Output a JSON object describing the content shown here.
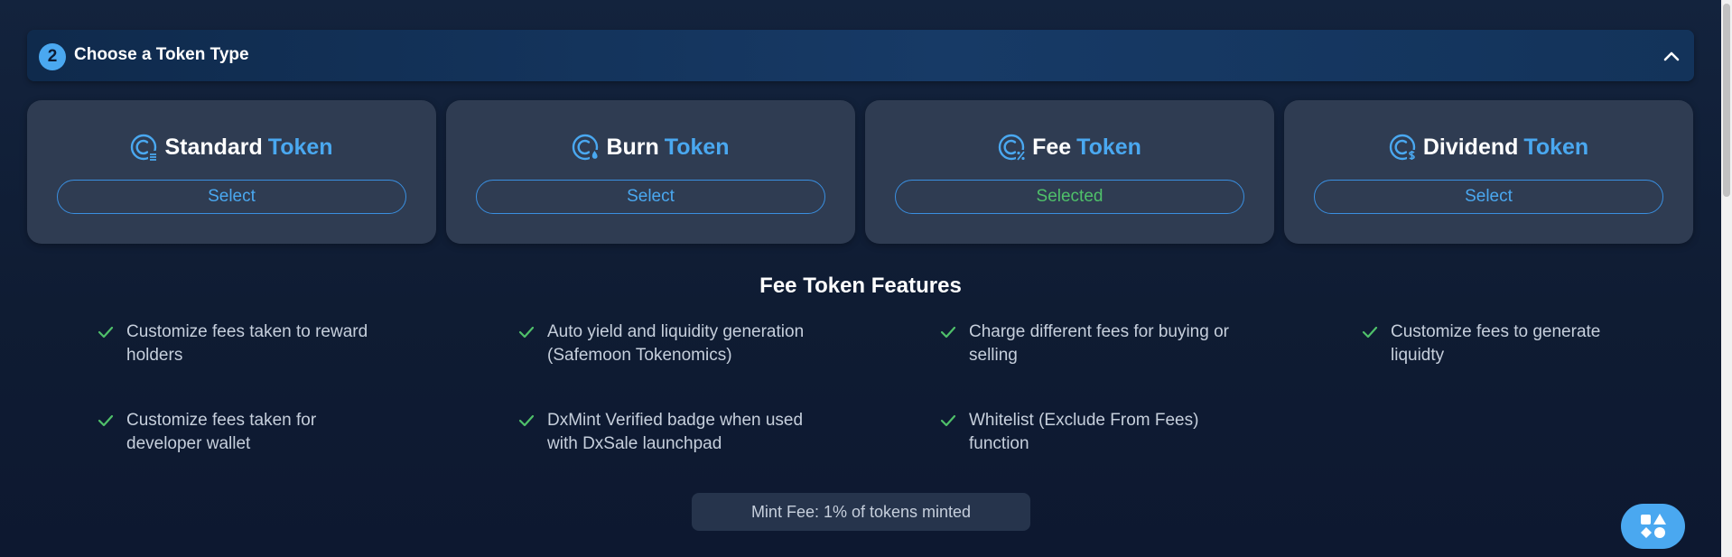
{
  "section": {
    "step_number": "2",
    "title": "Choose a Token Type",
    "collapse_icon": "chevron-up-icon"
  },
  "token_types": [
    {
      "name": "Standard",
      "suffix": "Token",
      "button": "Select",
      "selected": false,
      "icon": "coin-standard-icon"
    },
    {
      "name": "Burn",
      "suffix": "Token",
      "button": "Select",
      "selected": false,
      "icon": "coin-burn-icon"
    },
    {
      "name": "Fee",
      "suffix": "Token",
      "button": "Selected",
      "selected": true,
      "icon": "coin-fee-icon"
    },
    {
      "name": "Dividend",
      "suffix": "Token",
      "button": "Select",
      "selected": false,
      "icon": "coin-dividend-icon"
    }
  ],
  "features": {
    "title": "Fee Token Features",
    "items": [
      "Customize fees taken to reward holders",
      "Auto yield and liquidity generation (Safemoon Tokenomics)",
      "Charge different fees for buying or selling",
      "Customize fees to generate liquidty",
      "Customize fees taken for developer wallet",
      "DxMint Verified badge when used with DxSale launchpad",
      "Whitelist (Exclude From Fees) function"
    ]
  },
  "mint_fee": "Mint Fee: 1% of tokens minted",
  "colors": {
    "accent": "#4aa8f0",
    "selected": "#4fc06a",
    "card_bg": "#2f3c52",
    "page_bg": "#0f1c33"
  },
  "fab_icon": "shapes-icon"
}
